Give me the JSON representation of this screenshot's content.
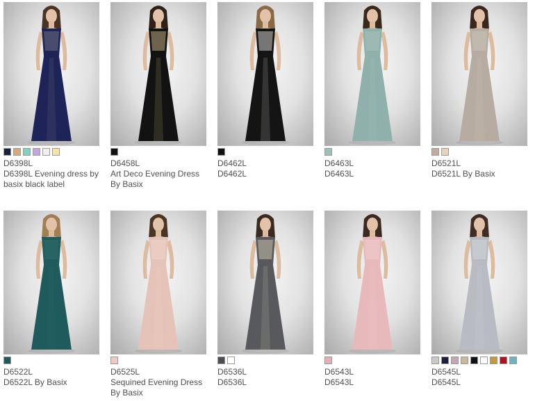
{
  "products": [
    {
      "code": "D6398L",
      "name": "D6398L Evening dress by basix black label",
      "dress_color": "#1f2458",
      "accent_color": "#6b6d80",
      "hair_color": "#4a3325",
      "swatches": [
        "#1a1f3c",
        "#d9a77a",
        "#7fd1c3",
        "#c7a3e0",
        "#efeff2",
        "#f3e6a6"
      ]
    },
    {
      "code": "D6458L",
      "name": "Art Deco Evening Dress By Basix",
      "dress_color": "#121212",
      "accent_color": "#b9a67c",
      "hair_color": "#2f2119",
      "swatches": [
        "#111111"
      ]
    },
    {
      "code": "D6462L",
      "name": "D6462L",
      "dress_color": "#141414",
      "accent_color": "#c9c7c2",
      "hair_color": "#8a6a44",
      "swatches": [
        "#111111"
      ]
    },
    {
      "code": "D6463L",
      "name": "D6463L",
      "dress_color": "#8fb0ab",
      "accent_color": "#a7c1bc",
      "hair_color": "#3b281d",
      "swatches": [
        "#9fc0b9"
      ]
    },
    {
      "code": "D6521L",
      "name": "D6521L By Basix",
      "dress_color": "#b7aca2",
      "accent_color": "#cbc2b8",
      "hair_color": "#3a281f",
      "swatches": [
        "#c3aa9c",
        "#e6d2be"
      ]
    },
    {
      "code": "D6522L",
      "name": "D6522L By Basix",
      "dress_color": "#1f5b5c",
      "accent_color": "#2d6b6a",
      "hair_color": "#a07f55",
      "swatches": [
        "#1d5a5e"
      ]
    },
    {
      "code": "D6525L",
      "name": "Sequined Evening Dress By Basix",
      "dress_color": "#e6c3b8",
      "accent_color": "#efd4ca",
      "hair_color": "#4a3426",
      "swatches": [
        "#efc9c2"
      ]
    },
    {
      "code": "D6536L",
      "name": "D6536L",
      "dress_color": "#57595d",
      "accent_color": "#c8bea7",
      "hair_color": "#3b2a20",
      "swatches": [
        "#4b4f55",
        "#ffffff"
      ]
    },
    {
      "code": "D6543L",
      "name": "D6543L",
      "dress_color": "#e7b9bb",
      "accent_color": "#f0cdcf",
      "hair_color": "#3a2a22",
      "swatches": [
        "#e2b1b3"
      ]
    },
    {
      "code": "D6545L",
      "name": "D6545L",
      "dress_color": "#b8bcc2",
      "accent_color": "#d2d5d9",
      "hair_color": "#3f2c22",
      "swatches": [
        "#c9c9c9",
        "#1c1f3f",
        "#c6a5b6",
        "#c9b89a",
        "#111111",
        "#ffffff",
        "#c49a3a",
        "#b01020",
        "#6fb3c0"
      ]
    }
  ]
}
